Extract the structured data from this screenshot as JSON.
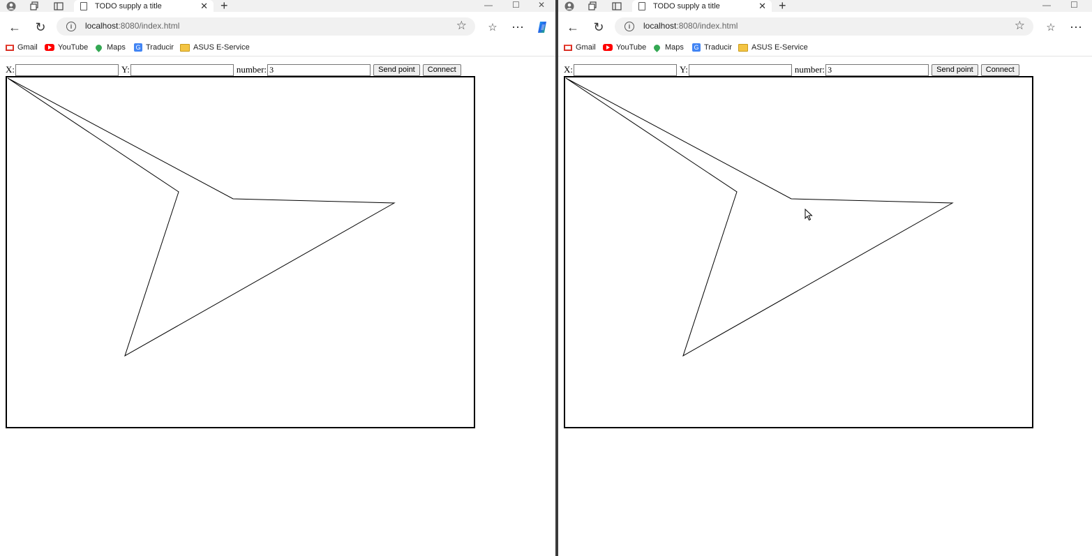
{
  "windows": [
    {
      "tab_title": "TODO supply a title",
      "url_host": "localhost",
      "url_rest": ":8080/index.html",
      "bookmarks": [
        "Gmail",
        "YouTube",
        "Maps",
        "Traducir",
        "ASUS E-Service"
      ],
      "form": {
        "x_label": "X:",
        "y_label": "Y:",
        "number_label": "number:",
        "x_value": "",
        "y_value": "",
        "number_value": "3",
        "send_label": "Send point",
        "connect_label": "Connect"
      },
      "polygon": [
        [
          1,
          1
        ],
        [
          246,
          164
        ],
        [
          169,
          399
        ],
        [
          555,
          180
        ],
        [
          324,
          174
        ]
      ]
    },
    {
      "tab_title": "TODO supply a title",
      "url_host": "localhost",
      "url_rest": ":8080/index.html",
      "bookmarks": [
        "Gmail",
        "YouTube",
        "Maps",
        "Traducir",
        "ASUS E-Service"
      ],
      "form": {
        "x_label": "X:",
        "y_label": "Y:",
        "number_label": "number:",
        "x_value": "",
        "y_value": "",
        "number_value": "3",
        "send_label": "Send point",
        "connect_label": "Connect"
      },
      "polygon": [
        [
          1,
          1
        ],
        [
          246,
          164
        ],
        [
          169,
          399
        ],
        [
          555,
          180
        ],
        [
          324,
          174
        ]
      ]
    }
  ]
}
